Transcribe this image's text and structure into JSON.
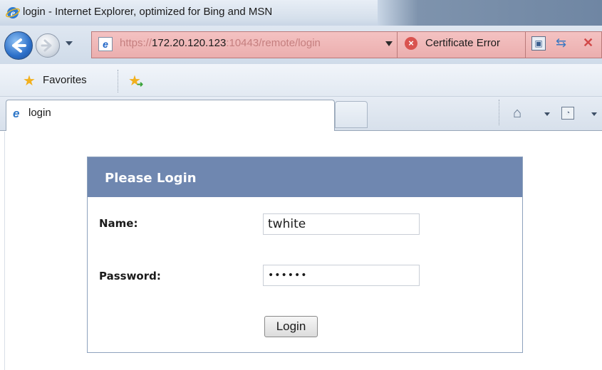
{
  "window": {
    "title": "login - Internet Explorer, optimized for Bing and MSN"
  },
  "address_bar": {
    "url_prefix": "https://",
    "url_host": "172.20.120.123",
    "url_suffix": ":10443/remote/login",
    "security_label": "Certificate Error"
  },
  "favorites_bar": {
    "favorites_label": "Favorites"
  },
  "tabs": [
    {
      "label": "login",
      "active": true
    }
  ],
  "login_form": {
    "title": "Please Login",
    "name_label": "Name:",
    "name_value": "twhite",
    "password_label": "Password:",
    "password_value": "••••••",
    "submit_label": "Login"
  },
  "colors": {
    "header_bg": "#6f87b0",
    "address_bar_error": "#f4c2c2"
  },
  "icons": [
    "ie-icon",
    "back-icon",
    "forward-icon",
    "page-icon",
    "certificate-error-icon",
    "compatibility-icon",
    "refresh-icon",
    "stop-icon",
    "favorites-star-icon",
    "add-favorites-icon",
    "home-icon",
    "feeds-icon"
  ]
}
